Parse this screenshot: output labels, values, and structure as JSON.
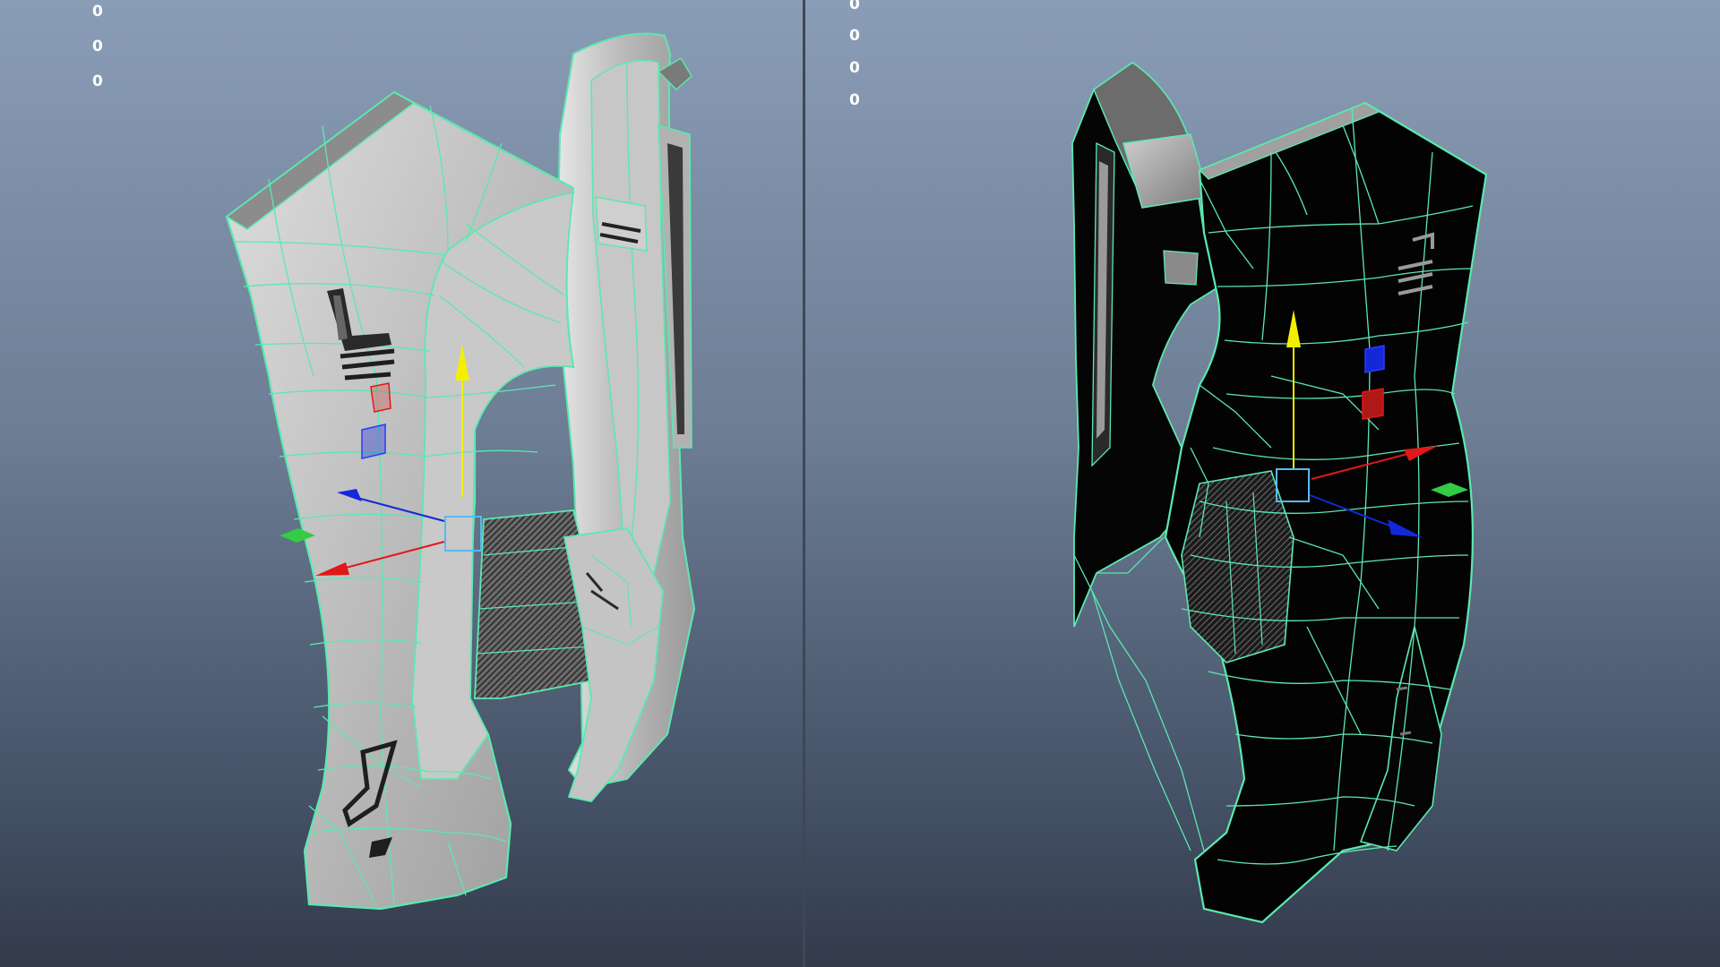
{
  "app": {
    "colors": {
      "wireframe": "#5ce8b0",
      "viewport_top": "#8a9db6",
      "viewport_bottom": "#323b4a",
      "axis_x": "#e01818",
      "axis_y": "#f2f000",
      "axis_z": "#1428d8",
      "manipulator_center": "#5ab8f0",
      "shading_textured": "#b9b9b9",
      "shading_dark": "#050505"
    }
  },
  "viewports": {
    "left": {
      "hud_values": [
        "0",
        "0",
        "0"
      ],
      "shading": "textured",
      "icons": [
        "move-manipulator-icon",
        "x-axis-arrow-icon",
        "y-axis-arrow-icon",
        "z-axis-arrow-icon",
        "xy-plane-handle-icon",
        "yz-plane-handle-icon",
        "xz-plane-handle-icon"
      ]
    },
    "right": {
      "hud_values": [
        "0",
        "0",
        "0",
        "0"
      ],
      "shading": "dark",
      "icons": [
        "move-manipulator-icon",
        "x-axis-arrow-icon",
        "y-axis-arrow-icon",
        "z-axis-arrow-icon",
        "xy-plane-handle-icon",
        "yz-plane-handle-icon",
        "xz-plane-handle-icon"
      ]
    }
  }
}
